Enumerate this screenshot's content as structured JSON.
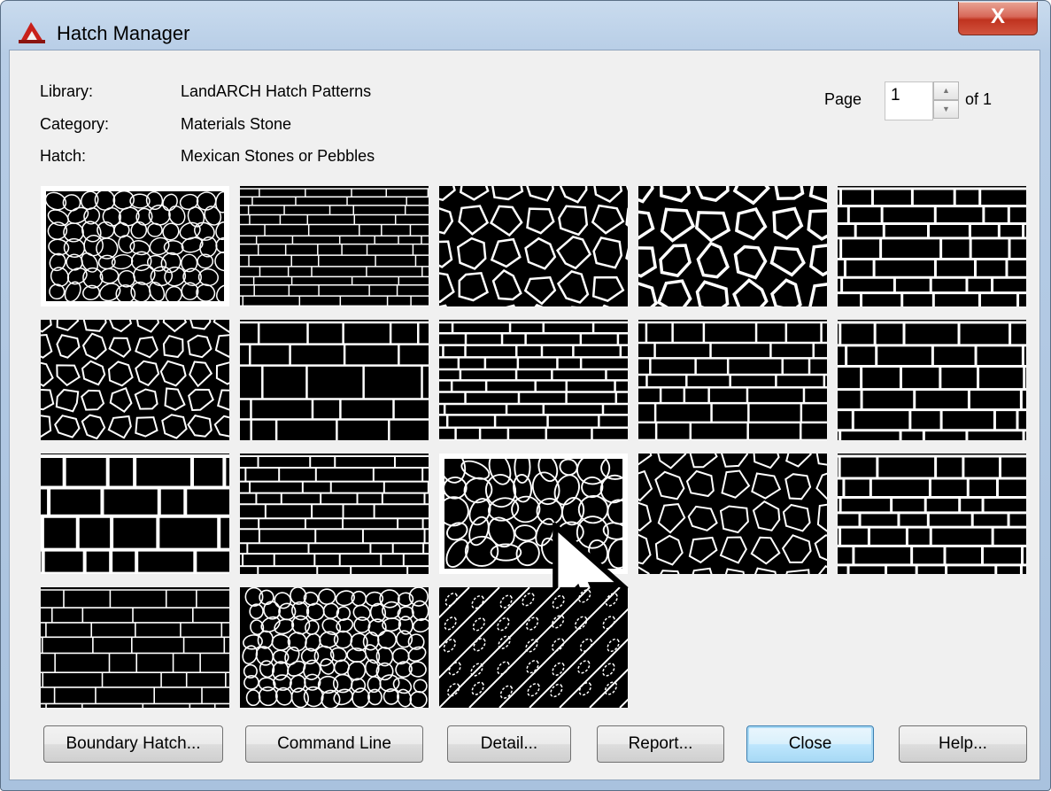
{
  "window": {
    "title": "Hatch Manager",
    "close_glyph": "X"
  },
  "info": {
    "library_label": "Library:",
    "library_value": "LandARCH Hatch Patterns",
    "category_label": "Category:",
    "category_value": "Materials Stone",
    "hatch_label": "Hatch:",
    "hatch_value": "Mexican Stones or Pebbles"
  },
  "pager": {
    "page_label": "Page",
    "page_value": "1",
    "of_label": "of 1"
  },
  "patterns": [
    {
      "style": "pebbles",
      "selected": true
    },
    {
      "style": "ashlar-thin",
      "selected": false
    },
    {
      "style": "polygon",
      "selected": false
    },
    {
      "style": "flagstone",
      "selected": false
    },
    {
      "style": "ashlar-mixed",
      "selected": false
    },
    {
      "style": "crazy",
      "selected": false
    },
    {
      "style": "block-large",
      "selected": false
    },
    {
      "style": "running-bond",
      "selected": false
    },
    {
      "style": "ashlar-wide",
      "selected": false
    },
    {
      "style": "ashlar-bold",
      "selected": false
    },
    {
      "style": "block-bold",
      "selected": false
    },
    {
      "style": "rubble-course",
      "selected": false
    },
    {
      "style": "cobble-round",
      "selected": true
    },
    {
      "style": "flagstone-fine",
      "selected": false
    },
    {
      "style": "ashlar-grid",
      "selected": false
    },
    {
      "style": "split-face",
      "selected": false
    },
    {
      "style": "pebbles-dense",
      "selected": false
    },
    {
      "style": "diagonal-ovals",
      "selected": false
    }
  ],
  "buttons": {
    "boundary_hatch": "Boundary Hatch...",
    "command_line": "Command Line",
    "detail": "Detail...",
    "report": "Report...",
    "close": "Close",
    "help": "Help..."
  },
  "icons": {
    "app": "autocad-icon",
    "cursor": "mouse-pointer-icon"
  }
}
